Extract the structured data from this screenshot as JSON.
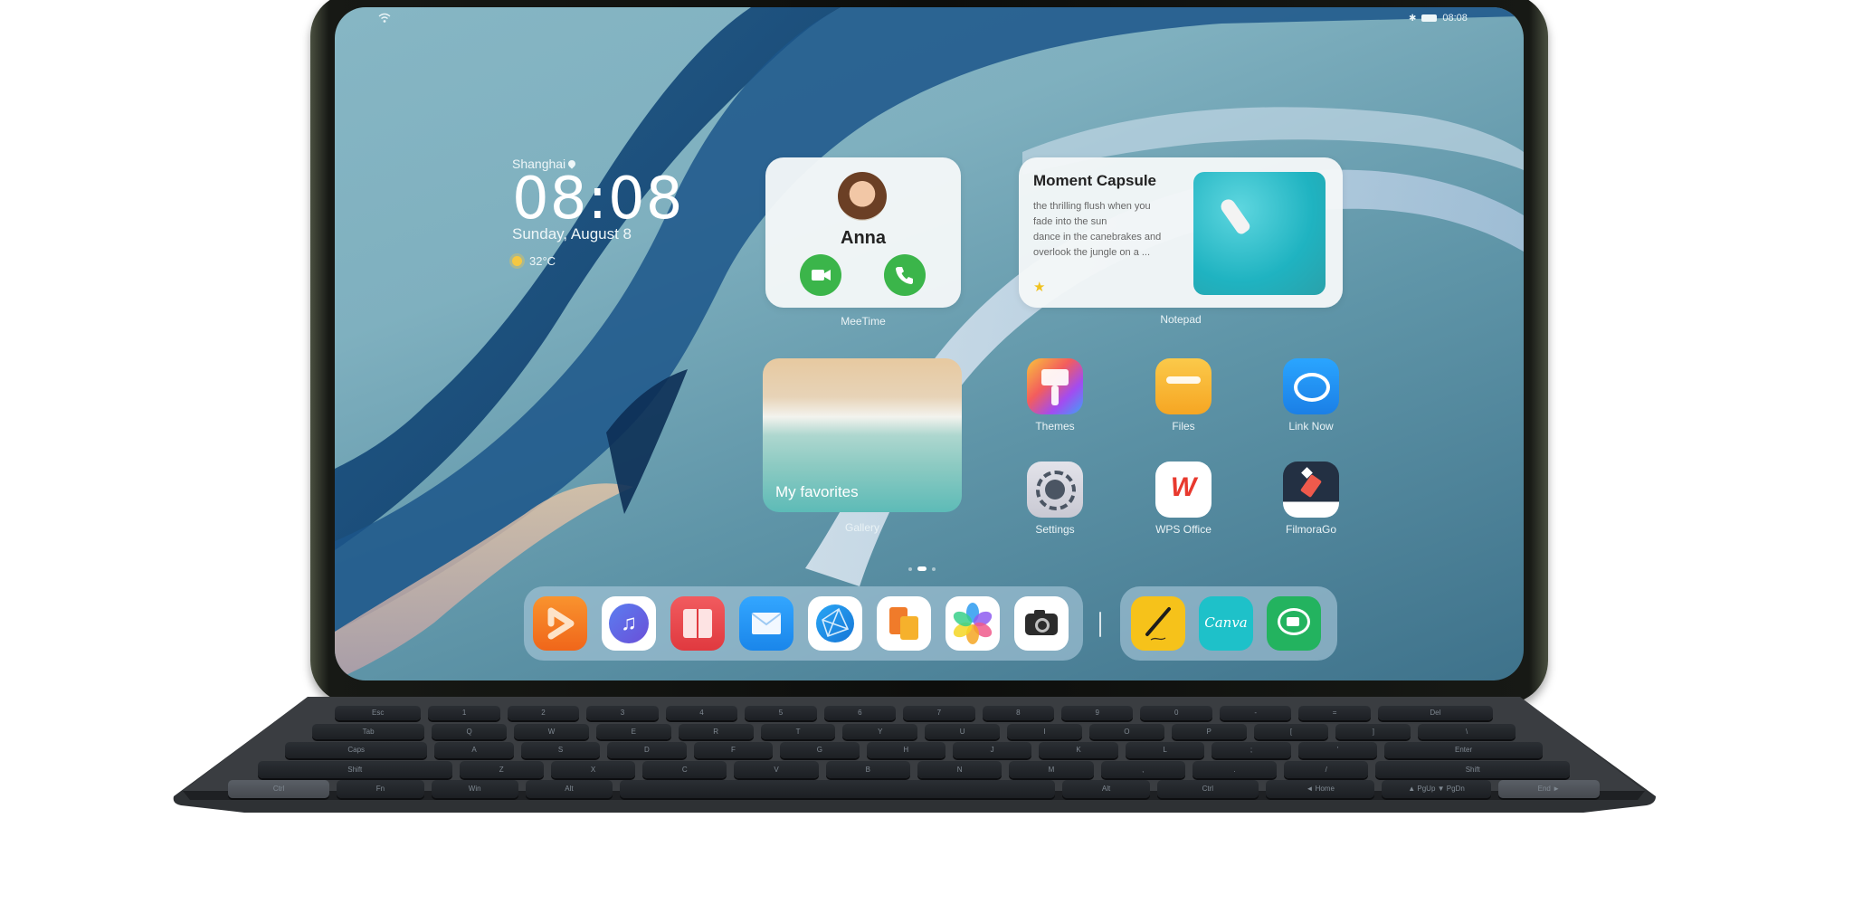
{
  "status_bar": {
    "wifi_icon": "wifi-icon",
    "bluetooth_icon": "bluetooth-icon",
    "battery_icon": "battery-icon",
    "time": "08:08"
  },
  "clock_widget": {
    "city": "Shanghai",
    "location_icon": "location-pin-icon",
    "time": "08:08",
    "date": "Sunday, August 8",
    "weather_icon": "sun-icon",
    "temperature": "32°C"
  },
  "meetime_widget": {
    "contact_name": "Anna",
    "video_call_icon": "video-call-icon",
    "voice_call_icon": "phone-icon",
    "app_label": "MeeTime",
    "accent_color": "#3bb54a"
  },
  "notepad_widget": {
    "title": "Moment Capsule",
    "lines": [
      "the thrilling flush when you",
      "fade into the sun",
      "dance in the canebrakes and",
      "overlook the jungle on a ..."
    ],
    "star_icon": "star-icon",
    "app_label": "Notepad"
  },
  "gallery_widget": {
    "album_title": "My favorites",
    "app_label": "Gallery"
  },
  "apps": [
    {
      "label": "Themes",
      "icon": "themes-brush-icon"
    },
    {
      "label": "Files",
      "icon": "files-folder-icon"
    },
    {
      "label": "Link Now",
      "icon": "link-now-icon"
    },
    {
      "label": "Settings",
      "icon": "settings-gear-icon"
    },
    {
      "label": "WPS Office",
      "icon": "wps-office-icon"
    },
    {
      "label": "FilmoraGo",
      "icon": "filmorago-icon"
    }
  ],
  "page_indicator": {
    "pages": 3,
    "current": 2
  },
  "dock": {
    "main": [
      {
        "name": "video",
        "icon": "video-play-icon",
        "color": "#f47a20"
      },
      {
        "name": "music",
        "icon": "music-note-icon",
        "color": "#4a6ad8"
      },
      {
        "name": "books",
        "icon": "book-icon",
        "color": "#e84a4f"
      },
      {
        "name": "email",
        "icon": "mail-icon",
        "color": "#1a8ff0"
      },
      {
        "name": "browser",
        "icon": "browser-globe-icon",
        "color": "#1b8fe6"
      },
      {
        "name": "docs",
        "icon": "documents-icon",
        "color": "#f08a2a"
      },
      {
        "name": "gallery",
        "icon": "gallery-flower-icon",
        "color": "#f5a623"
      },
      {
        "name": "camera",
        "icon": "camera-icon",
        "color": "#2c2c2c"
      }
    ],
    "recent": [
      {
        "name": "notes",
        "icon": "pen-signature-icon",
        "color": "#f6c21a"
      },
      {
        "name": "canva",
        "icon": "canva-icon",
        "label": "Canva",
        "color": "#1ec1c9"
      },
      {
        "name": "meetime",
        "icon": "meetime-chat-icon",
        "color": "#23b35f"
      }
    ]
  },
  "keyboard": {
    "rows": [
      [
        "Esc",
        "1",
        "2",
        "3",
        "4",
        "5",
        "6",
        "7",
        "8",
        "9",
        "0",
        "-",
        "=",
        "Del"
      ],
      [
        "Tab",
        "Q",
        "W",
        "E",
        "R",
        "T",
        "Y",
        "U",
        "I",
        "O",
        "P",
        "[",
        "]",
        "\\"
      ],
      [
        "Caps",
        "A",
        "S",
        "D",
        "F",
        "G",
        "H",
        "J",
        "K",
        "L",
        ";",
        "'",
        "Enter"
      ],
      [
        "Shift",
        "Z",
        "X",
        "C",
        "V",
        "B",
        "N",
        "M",
        ",",
        ".",
        "/",
        "Shift"
      ],
      [
        "Ctrl",
        "Fn",
        "Win",
        "Alt",
        "",
        "Alt",
        "Ctrl",
        "◄ Home",
        "▲ PgUp ▼ PgDn",
        "End ►"
      ]
    ]
  }
}
